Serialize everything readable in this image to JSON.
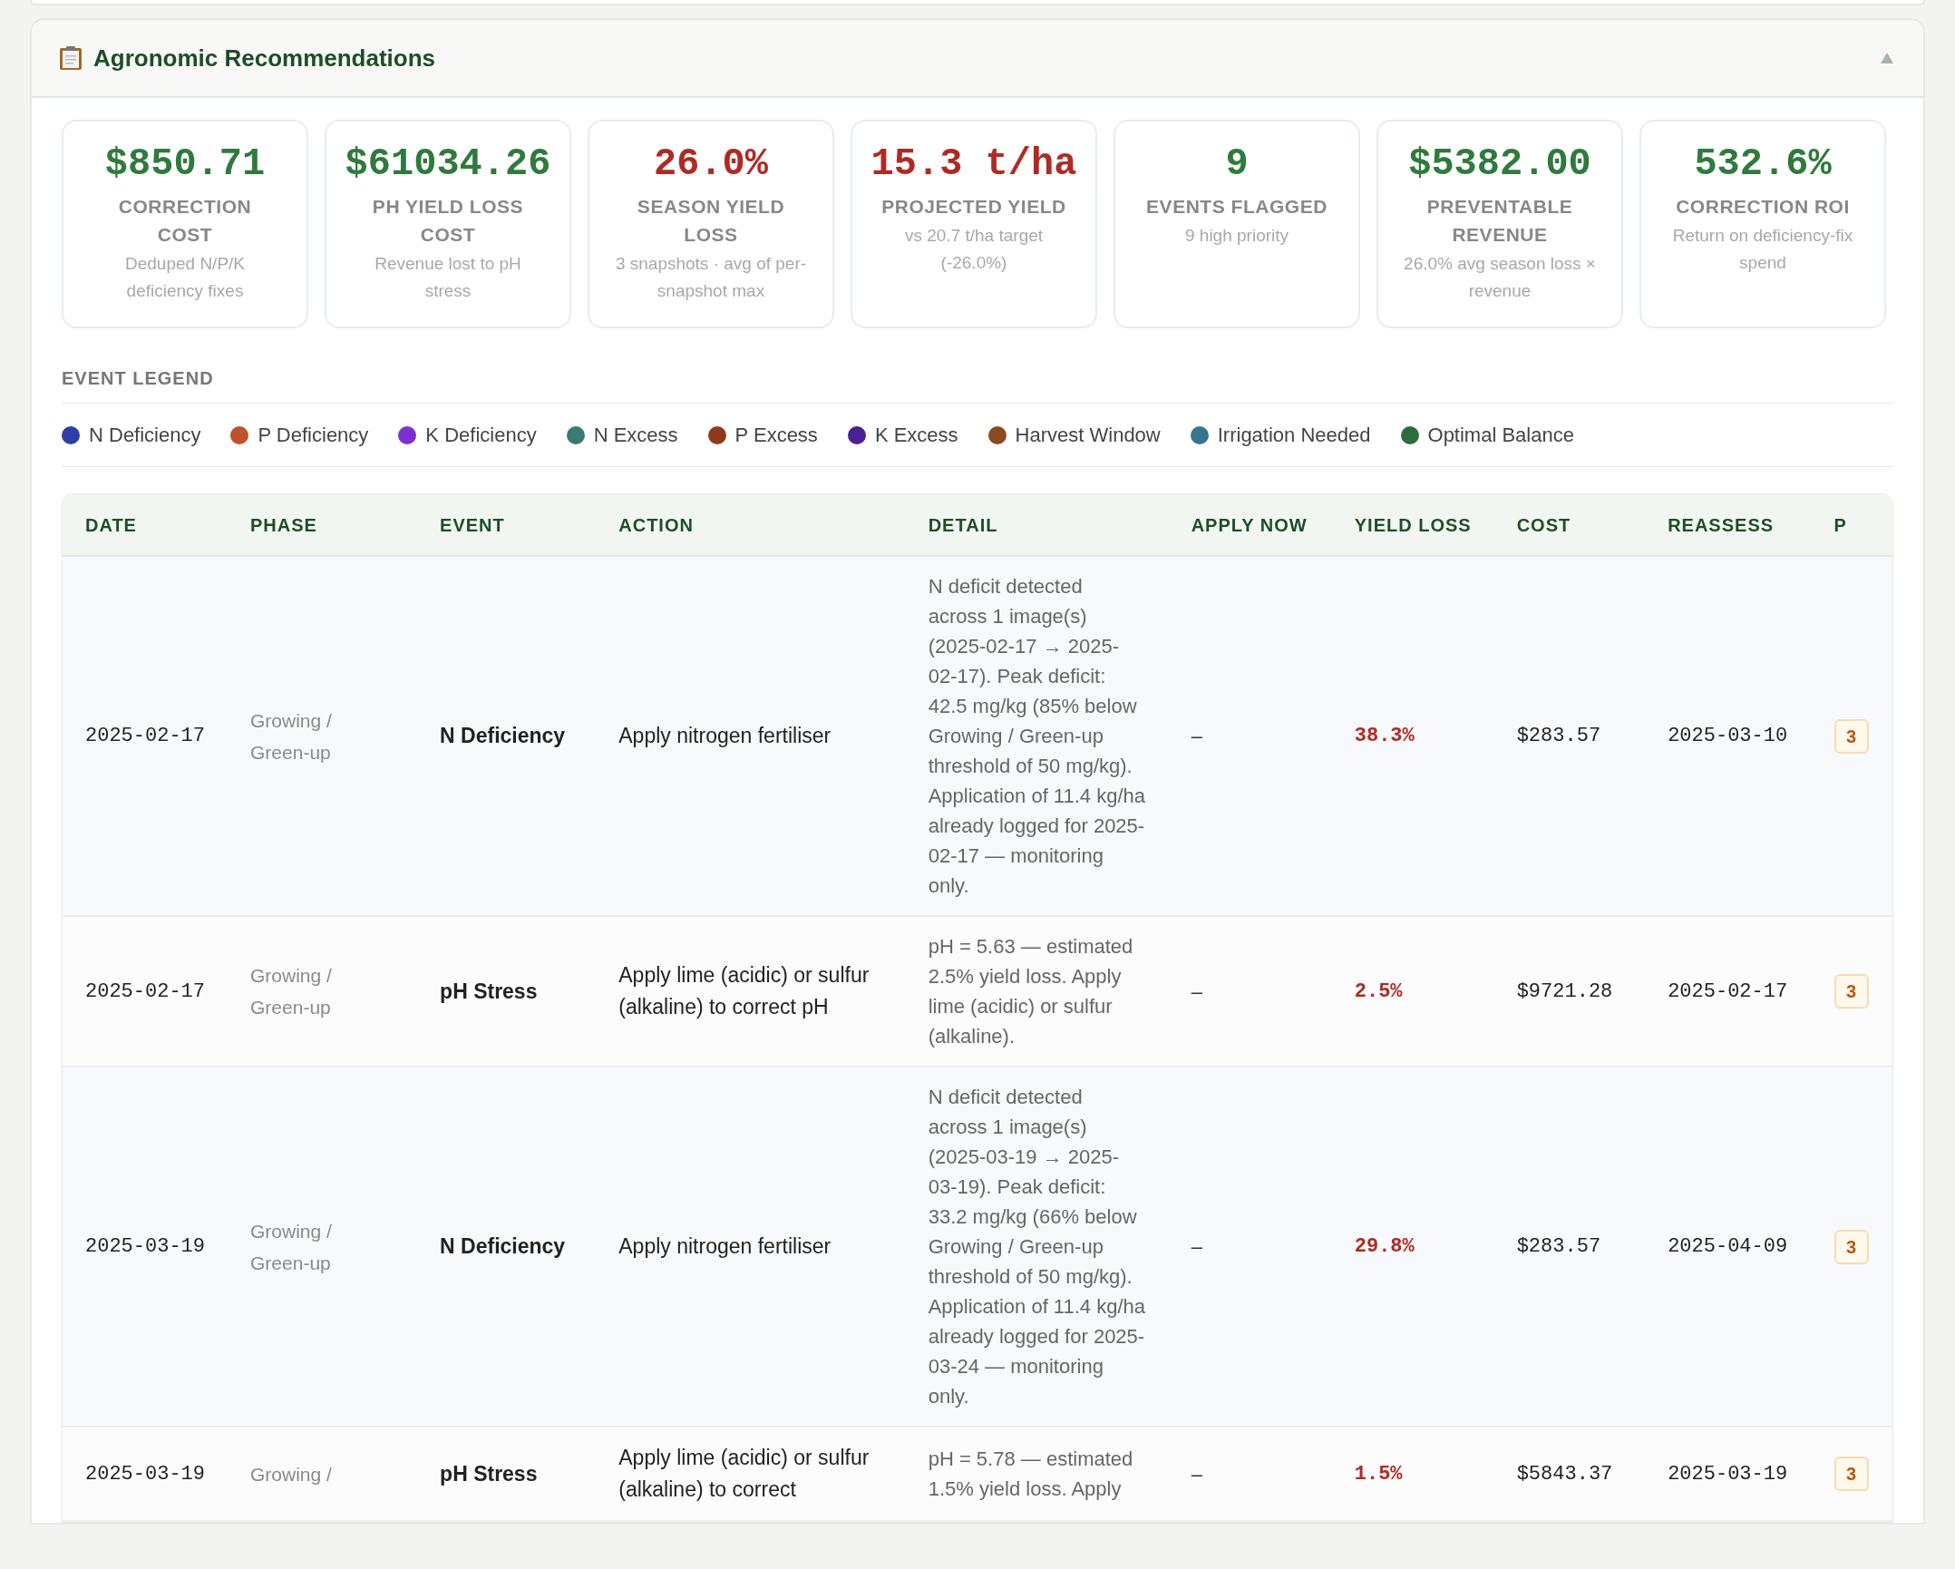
{
  "panel": {
    "title": "Agronomic Recommendations",
    "expanded": true
  },
  "kpis": [
    {
      "value": "$850.71",
      "label": "CORRECTION COST",
      "note": "Deduped N/P/K deficiency fixes",
      "color": "#2f7a3c"
    },
    {
      "value": "$61034.26",
      "label": "PH YIELD LOSS COST",
      "note": "Revenue lost to pH stress",
      "color": "#2f7a3c"
    },
    {
      "value": "26.0%",
      "label": "SEASON YIELD LOSS",
      "note": "3 snapshots · avg of per-snapshot max",
      "color": "#b02a24"
    },
    {
      "value": "15.3 t/ha",
      "label": "PROJECTED YIELD",
      "note": "vs 20.7 t/ha target (-26.0%)",
      "color": "#b02a24"
    },
    {
      "value": "9",
      "label": "EVENTS FLAGGED",
      "note": "9 high priority",
      "color": "#2f7a3c"
    },
    {
      "value": "$5382.00",
      "label": "PREVENTABLE REVENUE",
      "note": "26.0% avg season loss × revenue",
      "color": "#2f7a3c"
    },
    {
      "value": "532.6%",
      "label": "CORRECTION ROI",
      "note": "Return on deficiency-fix spend",
      "color": "#2f7a3c"
    }
  ],
  "legend": {
    "title": "EVENT LEGEND",
    "items": [
      {
        "label": "N Deficiency",
        "color": "#2f3fa8"
      },
      {
        "label": "P Deficiency",
        "color": "#c0522a"
      },
      {
        "label": "K Deficiency",
        "color": "#7d2fd0"
      },
      {
        "label": "N Excess",
        "color": "#3a7a73"
      },
      {
        "label": "P Excess",
        "color": "#8e3a1f"
      },
      {
        "label": "K Excess",
        "color": "#4a2296"
      },
      {
        "label": "Harvest Window",
        "color": "#8b4a1d"
      },
      {
        "label": "Irrigation Needed",
        "color": "#3a7390"
      },
      {
        "label": "Optimal Balance",
        "color": "#2e6b3d"
      }
    ]
  },
  "table": {
    "columns": [
      "DATE",
      "PHASE",
      "EVENT",
      "ACTION",
      "DETAIL",
      "APPLY NOW",
      "YIELD LOSS",
      "COST",
      "REASSESS",
      "P"
    ],
    "rows": [
      {
        "date": "2025-02-17",
        "phase": "Growing / Green-up",
        "event": "N Deficiency",
        "action": "Apply nitrogen fertiliser",
        "detail": "N deficit detected across 1 image(s) (2025-02-17 → 2025-02-17). Peak deficit: 42.5 mg/kg (85% below Growing / Green-up threshold of 50 mg/kg). Application of 11.4 kg/ha already logged for 2025-02-17 — monitoring only.",
        "apply_now": "–",
        "yield_loss": "38.3%",
        "cost": "$283.57",
        "reassess": "2025-03-10",
        "priority": "3"
      },
      {
        "date": "2025-02-17",
        "phase": "Growing / Green-up",
        "event": "pH Stress",
        "action": "Apply lime (acidic) or sulfur (alkaline) to correct pH",
        "detail": "pH = 5.63 — estimated 2.5% yield loss. Apply lime (acidic) or sulfur (alkaline).",
        "apply_now": "–",
        "yield_loss": "2.5%",
        "cost": "$9721.28",
        "reassess": "2025-02-17",
        "priority": "3"
      },
      {
        "date": "2025-03-19",
        "phase": "Growing / Green-up",
        "event": "N Deficiency",
        "action": "Apply nitrogen fertiliser",
        "detail": "N deficit detected across 1 image(s) (2025-03-19 → 2025-03-19). Peak deficit: 33.2 mg/kg (66% below Growing / Green-up threshold of 50 mg/kg). Application of 11.4 kg/ha already logged for 2025-03-24 — monitoring only.",
        "apply_now": "–",
        "yield_loss": "29.8%",
        "cost": "$283.57",
        "reassess": "2025-04-09",
        "priority": "3"
      },
      {
        "date": "2025-03-19",
        "phase": "Growing /",
        "event": "pH Stress",
        "action": "Apply lime (acidic) or sulfur (alkaline) to correct",
        "detail": "pH = 5.78 — estimated 1.5% yield loss. Apply",
        "apply_now": "–",
        "yield_loss": "1.5%",
        "cost": "$5843.37",
        "reassess": "2025-03-19",
        "priority": "3"
      }
    ]
  }
}
